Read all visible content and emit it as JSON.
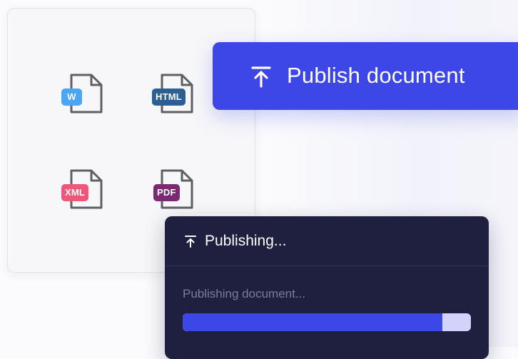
{
  "file_formats": [
    {
      "label": "W",
      "color": "#4ba6f5"
    },
    {
      "label": "HTML",
      "color": "#2c5f94"
    },
    {
      "label": "XML",
      "color": "#f0567a"
    },
    {
      "label": "PDF",
      "color": "#7a2a72"
    }
  ],
  "publish_button": {
    "label": "Publish document",
    "icon": "upload-arrow-icon",
    "color": "#3d46e6"
  },
  "publishing_panel": {
    "title": "Publishing...",
    "icon": "upload-arrow-icon",
    "status_text": "Publishing document...",
    "progress": 0.9
  }
}
